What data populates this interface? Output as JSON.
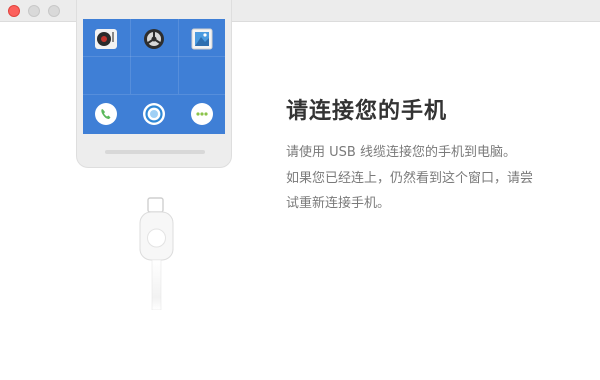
{
  "window": {
    "controls": [
      "close",
      "minimize",
      "maximize"
    ]
  },
  "phone": {
    "apps": [
      {
        "icon": "music-player-icon",
        "color": "#c2332c"
      },
      {
        "icon": "settings-gear-icon",
        "color": "#3a3a3a"
      },
      {
        "icon": "gallery-icon",
        "color": "#4b9be0"
      },
      {
        "icon": "phone-call-icon",
        "color": "#5cb85c"
      },
      {
        "icon": "browser-icon",
        "color": "#2f88d6"
      },
      {
        "icon": "messages-icon",
        "color": "#8bc34a"
      }
    ],
    "screen_color": "#3f7fd6"
  },
  "main": {
    "title": "请连接您的手机",
    "instructions": [
      "请使用 USB 线缆连接您的手机到电脑。",
      "如果您已经连上，仍然看到这个窗口，请尝",
      "试重新连接手机。"
    ]
  }
}
